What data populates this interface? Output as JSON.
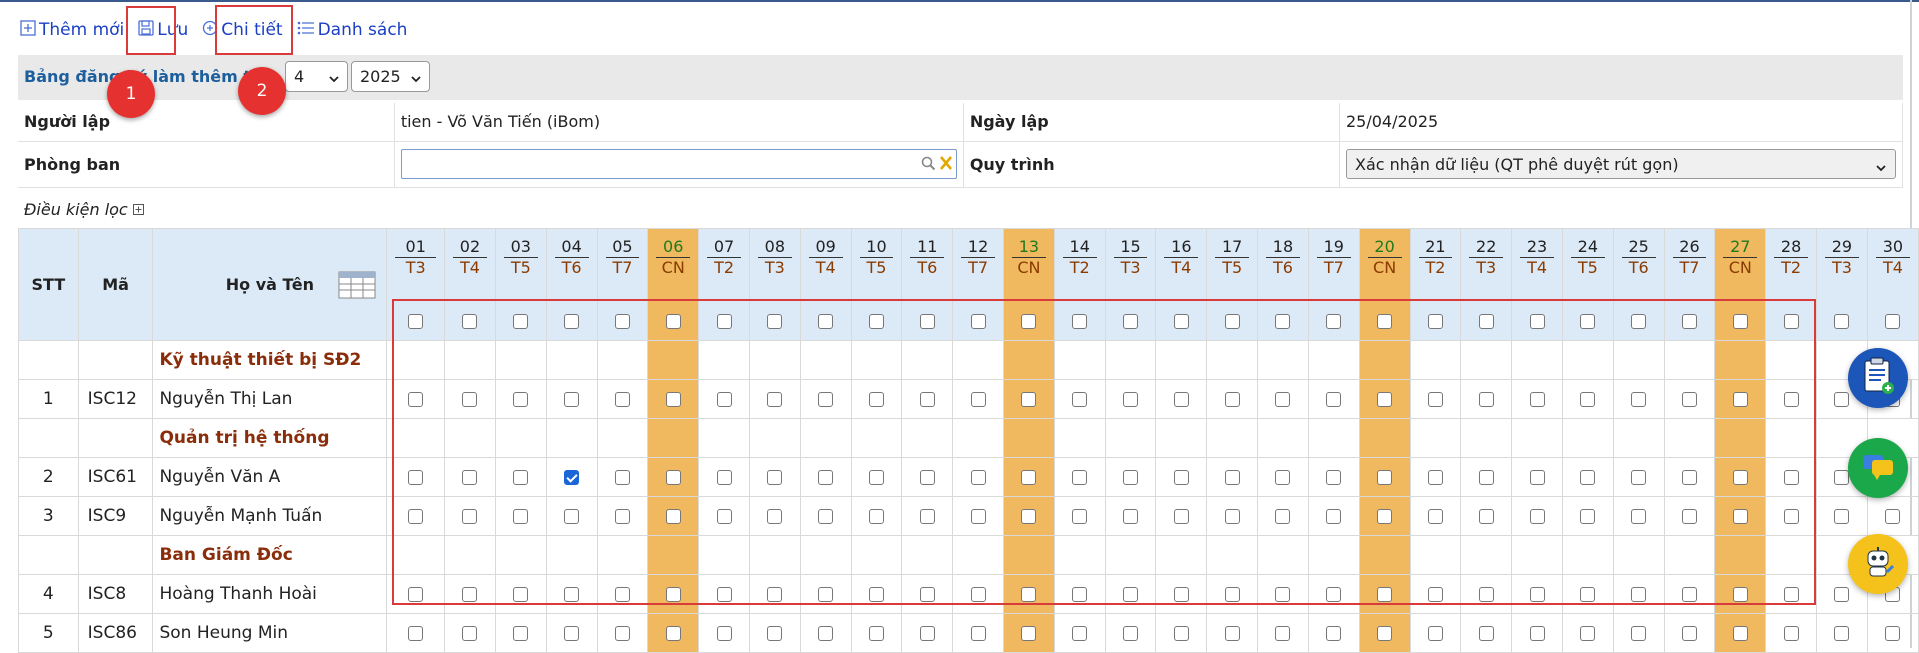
{
  "toolbar": {
    "add_label": "Thêm mới",
    "save_label": "Lưu",
    "detail_label": "Chi tiết",
    "list_label": "Danh sách"
  },
  "header": {
    "title": "Bảng đăng ký làm thêm th",
    "month": "4",
    "year": "2025"
  },
  "form": {
    "creator_label": "Người lập",
    "creator_value": "tien - Võ Văn Tiến (iBom)",
    "date_label": "Ngày lập",
    "date_value": "25/04/2025",
    "dept_label": "Phòng ban",
    "dept_value": "",
    "process_label": "Quy trình",
    "process_value": "Xác nhận dữ liệu (QT phê duyệt rút gọn)"
  },
  "filter_label": "Điều kiện lọc",
  "grid": {
    "col_stt": "STT",
    "col_code": "Mã",
    "col_name": "Họ và Tên",
    "days": [
      {
        "d": "01",
        "w": "T3"
      },
      {
        "d": "02",
        "w": "T4"
      },
      {
        "d": "03",
        "w": "T5"
      },
      {
        "d": "04",
        "w": "T6"
      },
      {
        "d": "05",
        "w": "T7"
      },
      {
        "d": "06",
        "w": "CN"
      },
      {
        "d": "07",
        "w": "T2"
      },
      {
        "d": "08",
        "w": "T3"
      },
      {
        "d": "09",
        "w": "T4"
      },
      {
        "d": "10",
        "w": "T5"
      },
      {
        "d": "11",
        "w": "T6"
      },
      {
        "d": "12",
        "w": "T7"
      },
      {
        "d": "13",
        "w": "CN"
      },
      {
        "d": "14",
        "w": "T2"
      },
      {
        "d": "15",
        "w": "T3"
      },
      {
        "d": "16",
        "w": "T4"
      },
      {
        "d": "17",
        "w": "T5"
      },
      {
        "d": "18",
        "w": "T6"
      },
      {
        "d": "19",
        "w": "T7"
      },
      {
        "d": "20",
        "w": "CN"
      },
      {
        "d": "21",
        "w": "T2"
      },
      {
        "d": "22",
        "w": "T3"
      },
      {
        "d": "23",
        "w": "T4"
      },
      {
        "d": "24",
        "w": "T5"
      },
      {
        "d": "25",
        "w": "T6"
      },
      {
        "d": "26",
        "w": "T7"
      },
      {
        "d": "27",
        "w": "CN"
      },
      {
        "d": "28",
        "w": "T2"
      },
      {
        "d": "29",
        "w": "T3"
      },
      {
        "d": "30",
        "w": "T4"
      }
    ],
    "rows": [
      {
        "type": "group",
        "name": "Kỹ thuật thiết bị SĐ2"
      },
      {
        "type": "emp",
        "stt": "1",
        "code": "ISC12",
        "name": "Nguyễn Thị Lan",
        "checked": []
      },
      {
        "type": "group",
        "name": "Quản trị hệ thống"
      },
      {
        "type": "emp",
        "stt": "2",
        "code": "ISC61",
        "name": "Nguyễn Văn A",
        "checked": [
          "04"
        ]
      },
      {
        "type": "emp",
        "stt": "3",
        "code": "ISC9",
        "name": "Nguyễn Mạnh Tuấn",
        "checked": []
      },
      {
        "type": "group",
        "name": "Ban Giám Đốc"
      },
      {
        "type": "emp",
        "stt": "4",
        "code": "ISC8",
        "name": "Hoàng Thanh Hoài",
        "checked": []
      },
      {
        "type": "emp",
        "stt": "5",
        "code": "ISC86",
        "name": "Son Heung Min",
        "checked": []
      }
    ]
  },
  "annotations": {
    "badge1": "1",
    "badge2": "2"
  },
  "colors": {
    "accent": "#1a3fc4",
    "sunday": "#f0b95f",
    "highlight_red": "#d93b3b",
    "group_text": "#8a2d0a"
  }
}
